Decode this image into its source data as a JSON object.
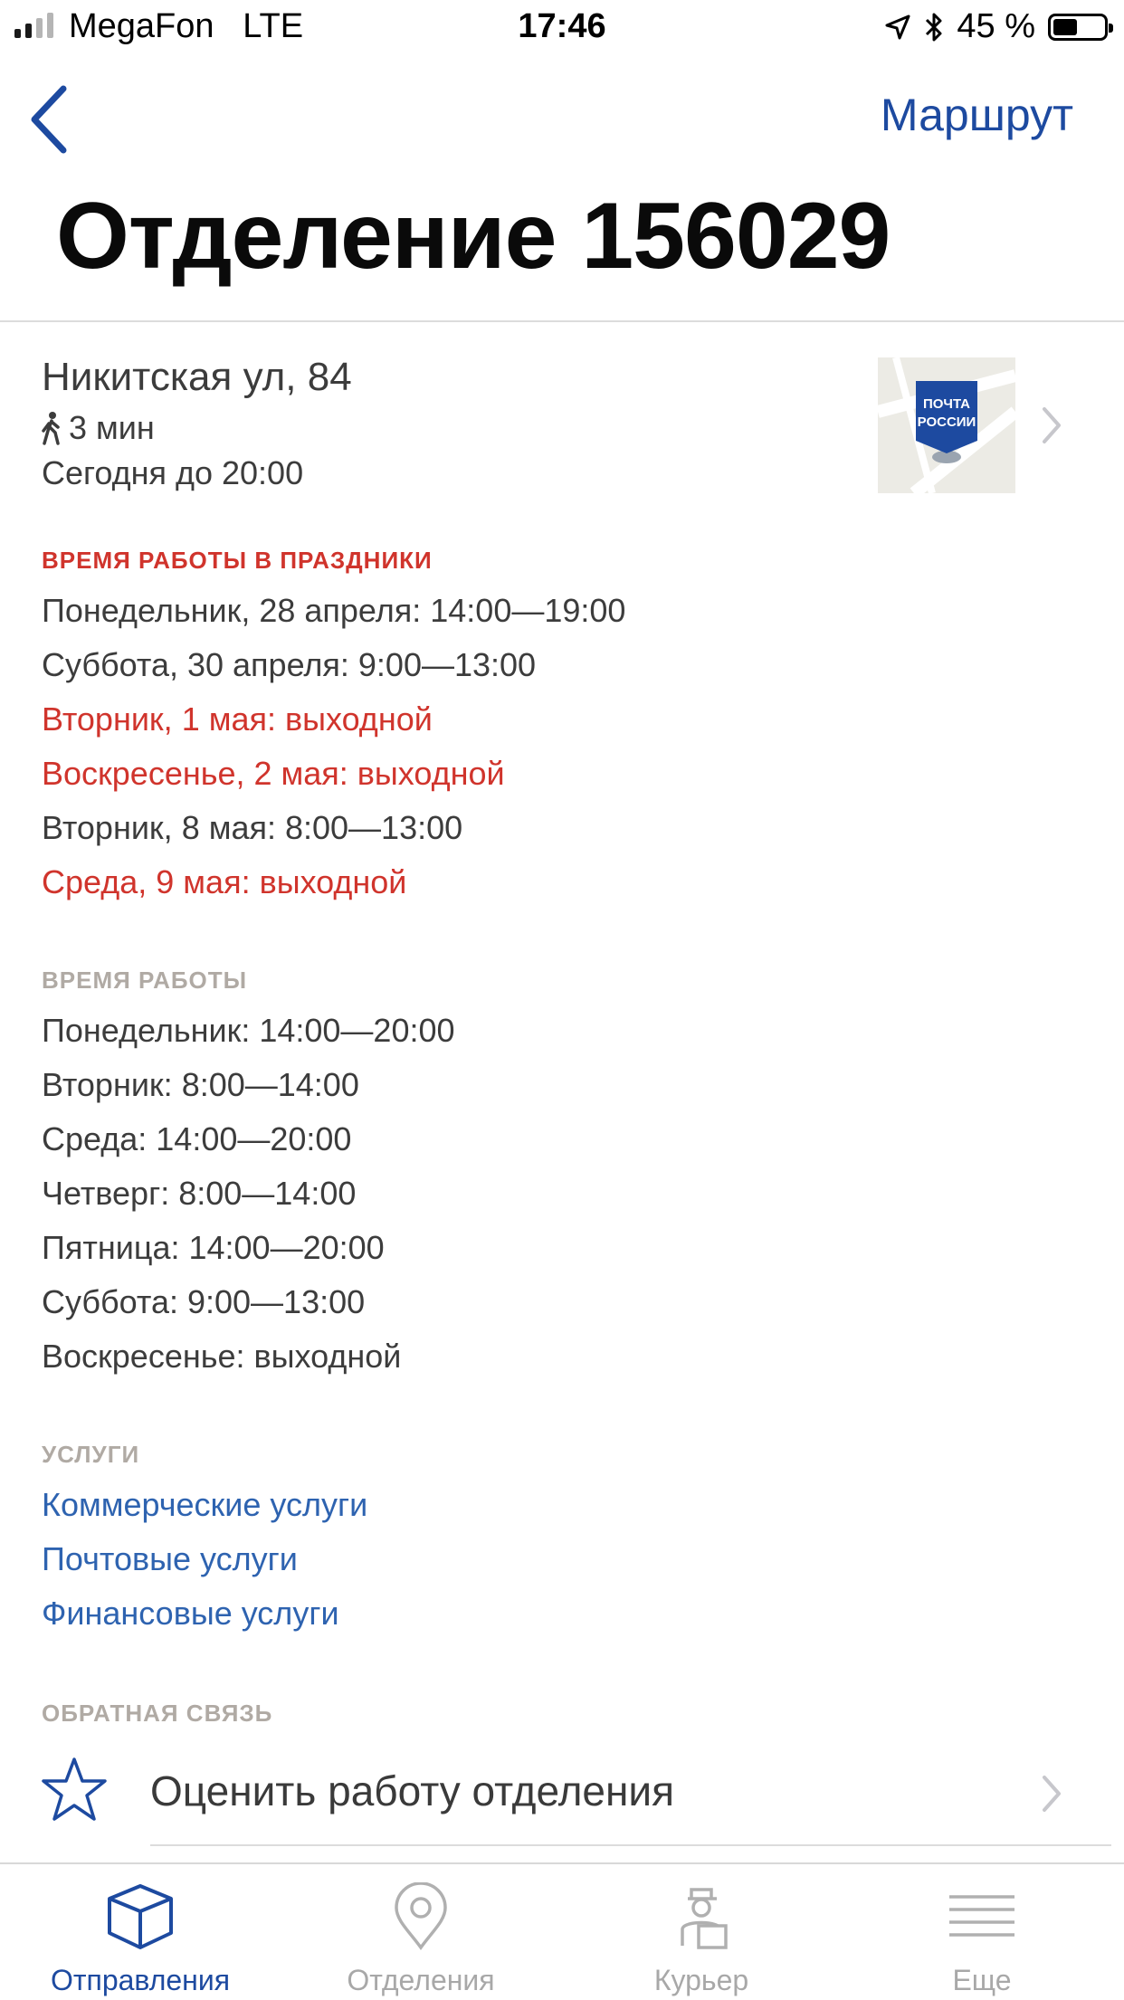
{
  "status_bar": {
    "carrier": "MegaFon   LTE",
    "time": "17:46",
    "battery": "45 %"
  },
  "nav": {
    "route_label": "Маршрут"
  },
  "title": "Отделение 156029",
  "office": {
    "address": "Никитская ул, 84",
    "walk_time": "3 мин",
    "today": "Сегодня до 20:00",
    "map_logo": "ПОЧТА РОССИИ"
  },
  "holiday_hours": {
    "heading": "ВРЕМЯ РАБОТЫ В ПРАЗДНИКИ",
    "items": [
      {
        "text": "Понедельник, 28 апреля: 14:00—19:00",
        "closed": false
      },
      {
        "text": "Суббота, 30 апреля: 9:00—13:00",
        "closed": false
      },
      {
        "text": "Вторник, 1 мая: выходной",
        "closed": true
      },
      {
        "text": "Воскресенье, 2 мая: выходной",
        "closed": true
      },
      {
        "text": "Вторник, 8 мая: 8:00—13:00",
        "closed": false
      },
      {
        "text": "Среда, 9 мая: выходной",
        "closed": true
      }
    ]
  },
  "regular_hours": {
    "heading": "ВРЕМЯ РАБОТЫ",
    "items": [
      "Понедельник: 14:00—20:00",
      "Вторник: 8:00—14:00",
      "Среда: 14:00—20:00",
      "Четверг: 8:00—14:00",
      "Пятница: 14:00—20:00",
      "Суббота: 9:00—13:00",
      "Воскресенье: выходной"
    ]
  },
  "services": {
    "heading": "УСЛУГИ",
    "items": [
      "Коммерческие услуги",
      "Почтовые услуги",
      "Финансовые услуги"
    ]
  },
  "feedback": {
    "heading": "ОБРАТНАЯ СВЯЗЬ",
    "rate_label": "Оценить работу отделения"
  },
  "tabs": [
    {
      "label": "Отправления",
      "icon": "box-icon",
      "active": true
    },
    {
      "label": "Отделения",
      "icon": "map-pin-icon",
      "active": false
    },
    {
      "label": "Курьер",
      "icon": "courier-icon",
      "active": false
    },
    {
      "label": "Еще",
      "icon": "menu-lines-icon",
      "active": false
    }
  ],
  "colors": {
    "accent": "#1d4aa0",
    "holiday_red": "#d0342c",
    "link_blue": "#2e63b0",
    "section_grey": "#b0aaa4"
  }
}
